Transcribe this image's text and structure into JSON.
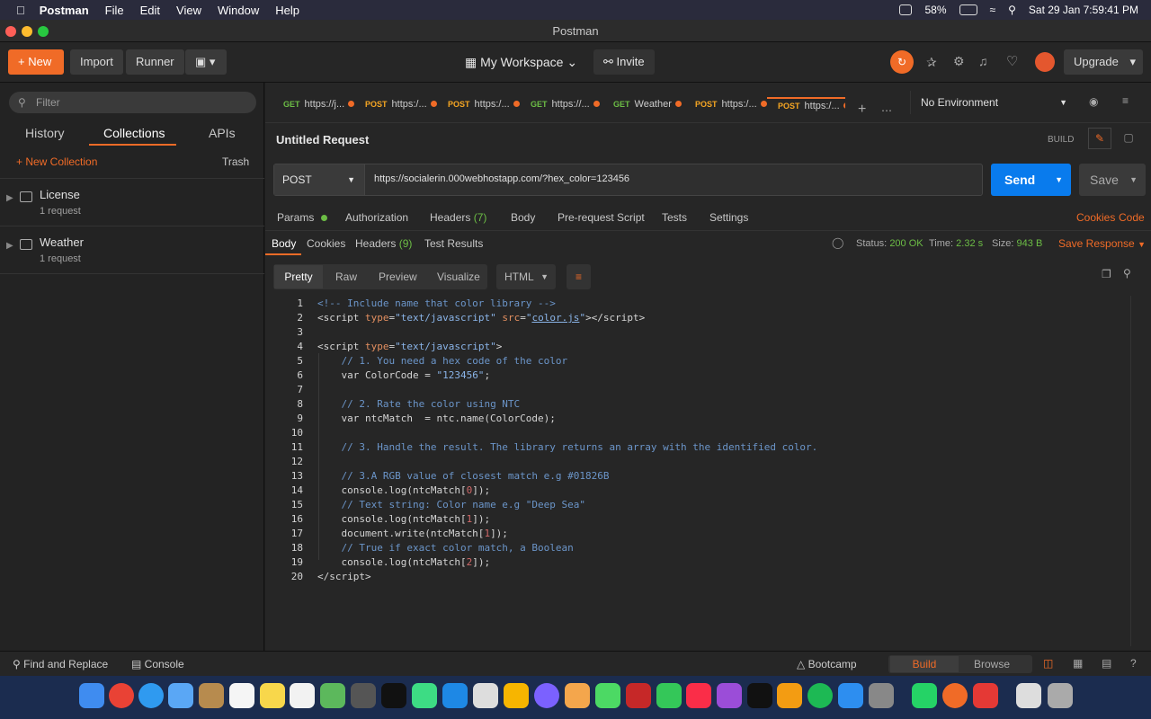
{
  "menubar": {
    "app": "Postman",
    "items": [
      "File",
      "Edit",
      "View",
      "Window",
      "Help"
    ],
    "battery": "58%",
    "clock": "Sat 29 Jan  7:59:41 PM"
  },
  "window": {
    "title": "Postman"
  },
  "header": {
    "new": "New",
    "import": "Import",
    "runner": "Runner",
    "workspace": "My Workspace",
    "invite": "Invite",
    "upgrade": "Upgrade"
  },
  "sidebar": {
    "filter_placeholder": "Filter",
    "tabs": [
      "History",
      "Collections",
      "APIs"
    ],
    "new_collection": "New Collection",
    "trash": "Trash",
    "collections": [
      {
        "name": "License",
        "sub": "1 request"
      },
      {
        "name": "Weather",
        "sub": "1 request"
      }
    ]
  },
  "tabs": [
    {
      "method": "GET",
      "label": "https://j..."
    },
    {
      "method": "POST",
      "label": "https:/..."
    },
    {
      "method": "POST",
      "label": "https:/..."
    },
    {
      "method": "GET",
      "label": "https://..."
    },
    {
      "method": "GET",
      "label": "Weather"
    },
    {
      "method": "POST",
      "label": "https:/..."
    },
    {
      "method": "POST",
      "label": "https:/..."
    }
  ],
  "env": {
    "selected": "No Environment"
  },
  "request": {
    "title": "Untitled Request",
    "build": "BUILD",
    "method": "POST",
    "url": "https://socialerin.000webhostapp.com/?hex_color=123456",
    "send": "Send",
    "save": "Save"
  },
  "req_tabs": {
    "params": "Params",
    "auth": "Authorization",
    "headers": "Headers",
    "headers_count": "(7)",
    "body": "Body",
    "prereq": "Pre-request Script",
    "tests": "Tests",
    "settings": "Settings",
    "cookies": "Cookies",
    "code": "Code"
  },
  "resp_tabs": {
    "body": "Body",
    "cookies": "Cookies",
    "headers": "Headers",
    "headers_count": "(9)",
    "tests": "Test Results",
    "status_label": "Status:",
    "status": "200 OK",
    "time_label": "Time:",
    "time": "2.32 s",
    "size_label": "Size:",
    "size": "943 B",
    "save_response": "Save Response"
  },
  "view_tabs": {
    "pretty": "Pretty",
    "raw": "Raw",
    "preview": "Preview",
    "visualize": "Visualize",
    "format": "HTML"
  },
  "footer": {
    "find": "Find and Replace",
    "console": "Console",
    "bootcamp": "Bootcamp",
    "build": "Build",
    "browse": "Browse"
  },
  "colors": {
    "accent": "#f06b27",
    "send": "#097bed",
    "ok": "#6cbd45"
  }
}
